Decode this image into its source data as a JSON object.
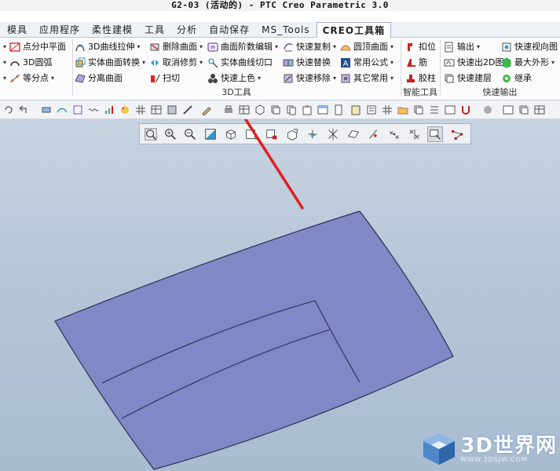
{
  "window": {
    "title": "G2-03 (活动的) - PTC Creo Parametric 3.0"
  },
  "tabs": [
    {
      "label": "模具",
      "active": false
    },
    {
      "label": "应用程序",
      "active": false
    },
    {
      "label": "柔性建模",
      "active": false
    },
    {
      "label": "工具",
      "active": false
    },
    {
      "label": "分析",
      "active": false
    },
    {
      "label": "自动保存",
      "active": false
    },
    {
      "label": "MS_Tools",
      "active": false
    },
    {
      "label": "CREO工具箱",
      "active": true
    }
  ],
  "ribbon": {
    "col1": [
      "点分中平面",
      "3D圆弧",
      "等分点"
    ],
    "col2": [
      "3D曲线拉伸",
      "实体曲面转换",
      "分离曲面"
    ],
    "col3": [
      "删除曲面",
      "取消修剪",
      "扫切"
    ],
    "col4": [
      "曲面阶数编辑",
      "实体曲线切口",
      "快速上色"
    ],
    "col5": [
      "快速复制",
      "快速替换",
      "快速移除"
    ],
    "col6": [
      "圆顶曲面",
      "常用公式",
      "其它常用"
    ],
    "col7": [
      "扣位",
      "筋",
      "胶柱"
    ],
    "col8": [
      "输出",
      "快速出2D图",
      "快速建层"
    ],
    "col9": [
      "快速视向图",
      "最大外形",
      "继承"
    ],
    "groups": {
      "g3d": "3D工具",
      "smart": "智能工具",
      "output": "快速输出"
    }
  },
  "colors": {
    "surface": "#8088c6",
    "arrow": "#e02020",
    "viewport_top": "#c7d3e1"
  },
  "watermark": {
    "main": "3D世界网",
    "sub": "WWW.3DSJW.COM"
  }
}
